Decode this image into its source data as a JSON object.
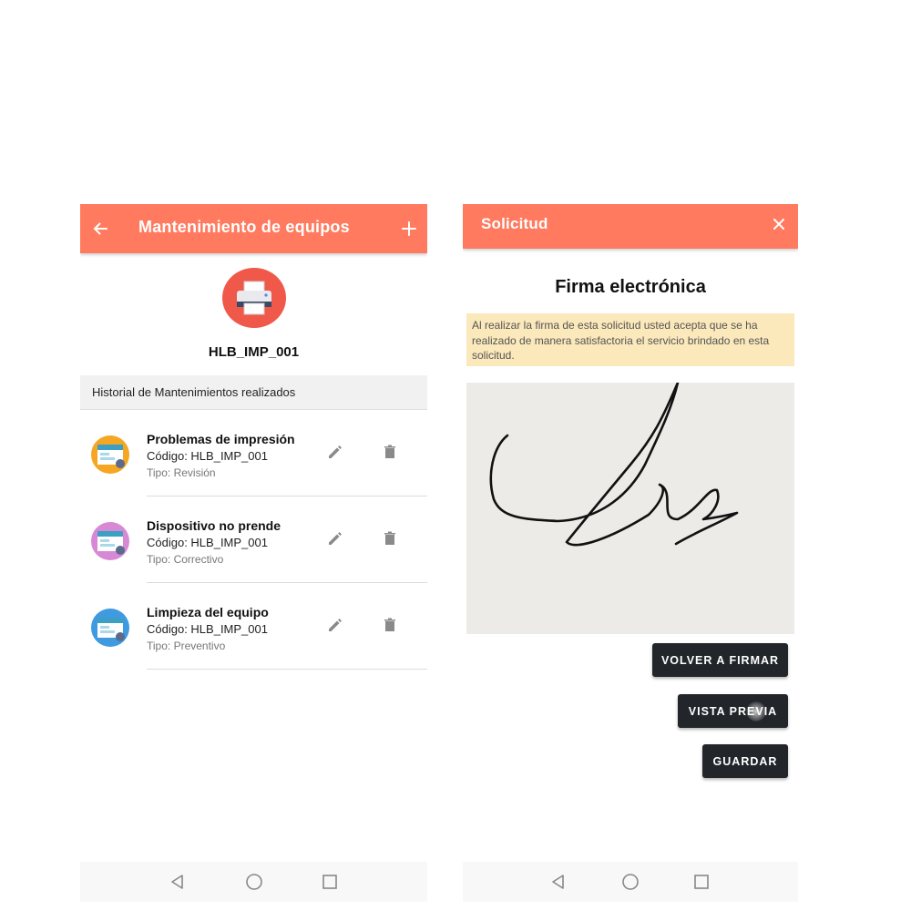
{
  "left_screen": {
    "appbar": {
      "title": "Mantenimiento de equipos",
      "back_icon": "arrow-left-icon",
      "add_icon": "plus-icon"
    },
    "device": {
      "icon": "printer-icon",
      "code": "HLB_IMP_001"
    },
    "history_header": "Historial de Mantenimientos realizados",
    "items": [
      {
        "title": "Problemas de impresión",
        "code": "Código: HLB_IMP_001",
        "type": "Tipo: Revisión",
        "thumb_color": "#f5a623"
      },
      {
        "title": "Dispositivo no prende",
        "code": "Código: HLB_IMP_001",
        "type": "Tipo: Correctivo",
        "thumb_color": "#d889d6"
      },
      {
        "title": "Limpieza del equipo",
        "code": "Código: HLB_IMP_001",
        "type": "Tipo: Preventivo",
        "thumb_color": "#3f9ae0"
      }
    ],
    "item_actions": {
      "edit_icon": "pencil-icon",
      "delete_icon": "trash-icon"
    }
  },
  "right_screen": {
    "appbar": {
      "title": "Solicitud",
      "close_icon": "close-icon"
    },
    "heading": "Firma electrónica",
    "notice": "Al realizar la firma de esta solicitud usted acepta que se ha realizado de manera satisfactoria el servicio brindado en esta solicitud.",
    "buttons": {
      "resign": "VOLVER A FIRMAR",
      "preview": "VISTA PREVIA",
      "save": "GUARDAR"
    }
  },
  "nav": {
    "back_icon": "triangle-back-icon",
    "home_icon": "circle-home-icon",
    "recents_icon": "square-recents-icon"
  },
  "colors": {
    "appbar": "#ff7a5e",
    "avatar": "#f0584a",
    "notice_bg": "#fbe8bb",
    "button_bg": "#22262a"
  }
}
